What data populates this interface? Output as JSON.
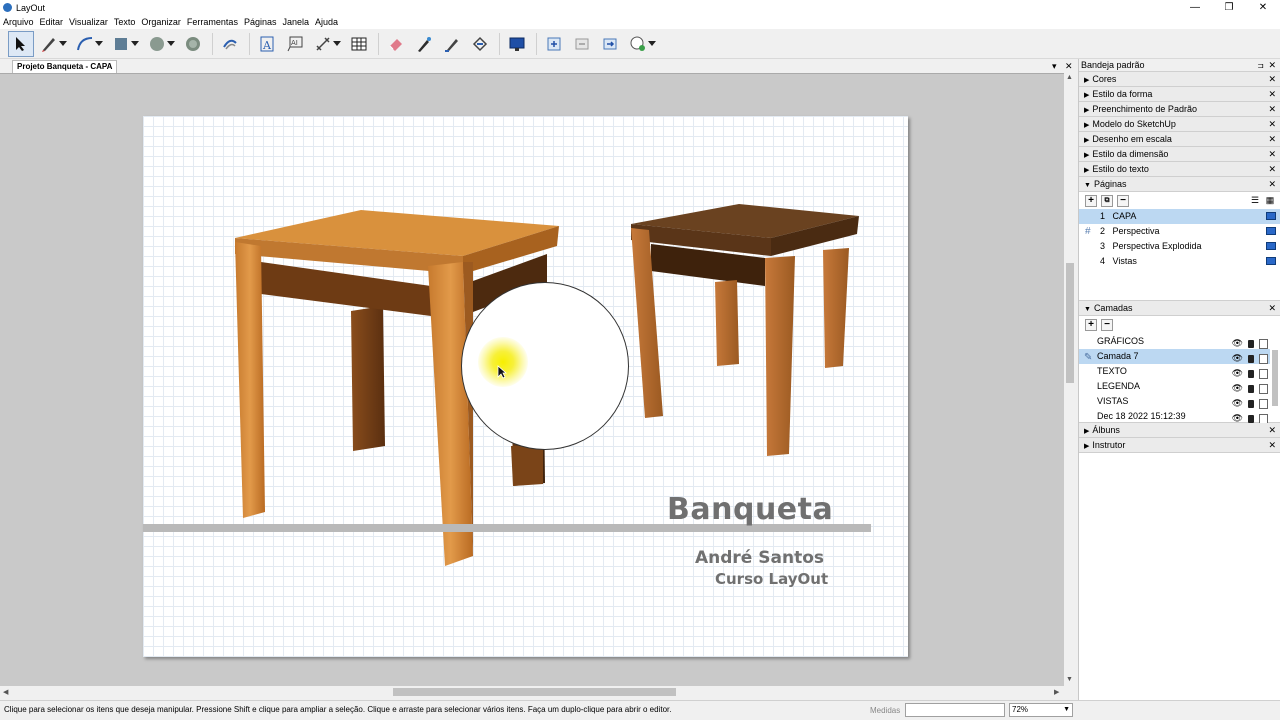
{
  "app": {
    "title": "LayOut"
  },
  "window_controls": {
    "minimize": "—",
    "restore": "❐",
    "close": "✕"
  },
  "menu": [
    "Arquivo",
    "Editar",
    "Visualizar",
    "Texto",
    "Organizar",
    "Ferramentas",
    "Páginas",
    "Janela",
    "Ajuda"
  ],
  "toolbar": {
    "tools": [
      "select-icon",
      "pencil-icon",
      "arc-icon",
      "rectangle-icon",
      "circle-icon",
      "polygon-icon",
      "offset-icon",
      "text-icon",
      "label-icon",
      "dimension-icon",
      "table-icon",
      "eraser-icon",
      "style-icon",
      "split-icon",
      "join-icon",
      "presentation-icon",
      "add-page-icon",
      "duplicate-page-icon",
      "next-page-icon",
      "sketchup-icon"
    ]
  },
  "document": {
    "tab_label": "Projeto Banqueta - CAPA",
    "tab_menu": "▾",
    "tab_close": "✕"
  },
  "cover": {
    "title": "Banqueta",
    "author": "André Santos",
    "course": "Curso LayOut"
  },
  "tray": {
    "title": "Bandeja padrão",
    "pin": "⊐",
    "close": "✕",
    "panels_top": [
      {
        "label": "Cores",
        "expanded": false
      },
      {
        "label": "Estilo da forma",
        "expanded": false
      },
      {
        "label": "Preenchimento de Padrão",
        "expanded": false
      },
      {
        "label": "Modelo do SketchUp",
        "expanded": false
      },
      {
        "label": "Desenho em escala",
        "expanded": false
      },
      {
        "label": "Estilo da dimensão",
        "expanded": false
      },
      {
        "label": "Estilo do texto",
        "expanded": false
      }
    ],
    "pages_panel": {
      "label": "Páginas",
      "items": [
        {
          "num": "1",
          "name": "CAPA",
          "selected": true,
          "hash": false
        },
        {
          "num": "2",
          "name": "Perspectiva",
          "selected": false,
          "hash": true
        },
        {
          "num": "3",
          "name": "Perspectiva Explodida",
          "selected": false,
          "hash": false
        },
        {
          "num": "4",
          "name": "Vistas",
          "selected": false,
          "hash": false
        }
      ]
    },
    "layers_panel": {
      "label": "Camadas",
      "items": [
        {
          "name": "GRÁFICOS",
          "selected": false,
          "active": false
        },
        {
          "name": "Camada 7",
          "selected": true,
          "active": true
        },
        {
          "name": "TEXTO",
          "selected": false,
          "active": false
        },
        {
          "name": "LEGENDA",
          "selected": false,
          "active": false
        },
        {
          "name": "VISTAS",
          "selected": false,
          "active": false
        },
        {
          "name": "Dec 18 2022 15:12:39",
          "selected": false,
          "active": false
        }
      ]
    },
    "panels_bottom": [
      {
        "label": "Álbuns",
        "expanded": false
      },
      {
        "label": "Instrutor",
        "expanded": false
      }
    ]
  },
  "status": {
    "message": "Clique para selecionar os itens que deseja manipular. Pressione Shift e clique para ampliar a seleção. Clique e arraste para selecionar vários itens. Faça um duplo-clique para abrir o editor.",
    "measures_label": "Medidas",
    "measures_value": "",
    "zoom": "72%"
  },
  "colors": {
    "accent": "#bcd8f2",
    "cover_text": "#707070",
    "wood_light": "#d98e3c",
    "wood_dark": "#5a3518"
  }
}
